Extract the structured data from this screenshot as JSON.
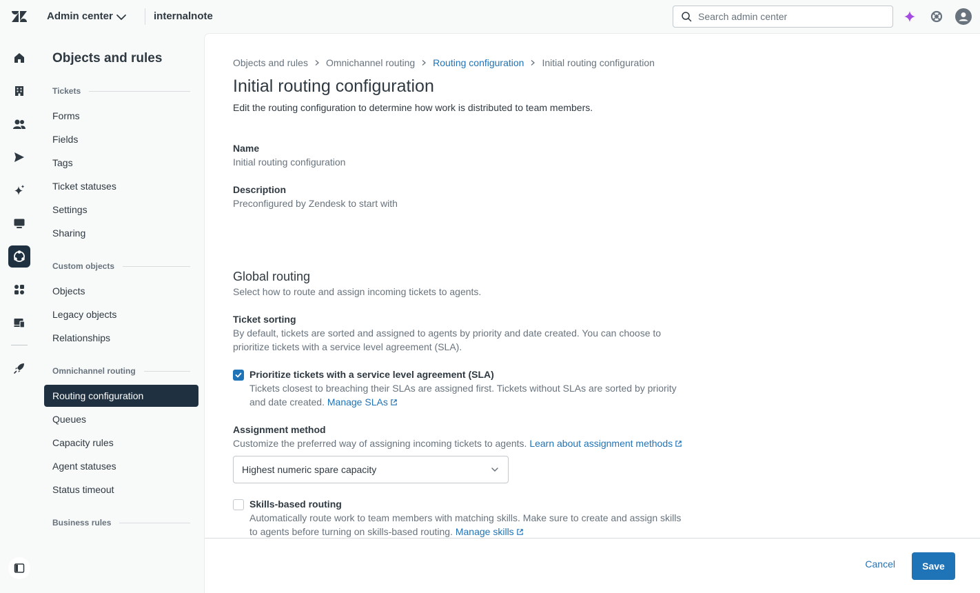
{
  "topbar": {
    "product": "Admin center",
    "account": "internalnote",
    "search_placeholder": "Search admin center"
  },
  "sidenav": {
    "title": "Objects and rules",
    "sections": [
      {
        "header": "Tickets",
        "items": [
          "Forms",
          "Fields",
          "Tags",
          "Ticket statuses",
          "Settings",
          "Sharing"
        ]
      },
      {
        "header": "Custom objects",
        "items": [
          "Objects",
          "Legacy objects",
          "Relationships"
        ]
      },
      {
        "header": "Omnichannel routing",
        "items": [
          "Routing configuration",
          "Queues",
          "Capacity rules",
          "Agent statuses",
          "Status timeout"
        ]
      },
      {
        "header": "Business rules",
        "items": []
      }
    ],
    "active_item": "Routing configuration"
  },
  "breadcrumb": [
    "Objects and rules",
    "Omnichannel routing",
    "Routing configuration",
    "Initial routing configuration"
  ],
  "page": {
    "title": "Initial routing configuration",
    "description": "Edit the routing configuration to determine how work is distributed to team members.",
    "name_label": "Name",
    "name_value": "Initial routing configuration",
    "description_label": "Description",
    "description_value": "Preconfigured by Zendesk to start with"
  },
  "global_routing": {
    "title": "Global routing",
    "subtitle": "Select how to route and assign incoming tickets to agents.",
    "ticket_sorting_label": "Ticket sorting",
    "ticket_sorting_hint_1": "By default, tickets are sorted and assigned to agents by priority and date created. You can choose to",
    "ticket_sorting_hint_2": "prioritize tickets with a service level agreement (SLA).",
    "sla_checkbox_label": "Prioritize tickets with a service level agreement (SLA)",
    "sla_checked": true,
    "sla_hint_1": "Tickets closest to breaching their SLAs are assigned first. Tickets without SLAs are sorted by priority",
    "sla_hint_2": "and date created.",
    "sla_link": "Manage SLAs",
    "assignment_label": "Assignment method",
    "assignment_hint": "Customize the preferred way of assigning incoming tickets to agents.",
    "assignment_link": "Learn about assignment methods",
    "assignment_value": "Highest numeric spare capacity",
    "skills_label": "Skills-based routing",
    "skills_checked": false,
    "skills_hint_1": "Automatically route work to team members with matching skills. Make sure to create and assign skills",
    "skills_hint_2": "to agents before turning on skills-based routing.",
    "skills_link": "Manage skills"
  },
  "footer": {
    "cancel": "Cancel",
    "save": "Save"
  },
  "colors": {
    "accent": "#1f73b7",
    "nav_active": "#1f3140",
    "ai_sparkle": "#a44ce2"
  }
}
